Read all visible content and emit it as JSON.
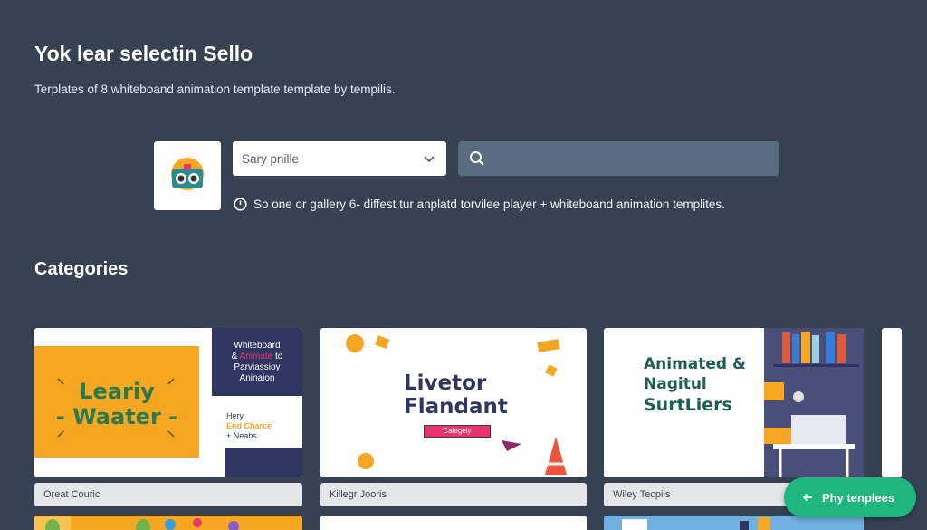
{
  "header": {
    "title": "Yok lear selectin Sello",
    "subtitle": "Terplates of 8 whiteboand animation template template by tempilis."
  },
  "controls": {
    "select_value": "Sary pnille",
    "search_placeholder": "",
    "hint": "So one or gallery 6- diffest tur anplatd torvilee player + whiteboand animation templites."
  },
  "categories": {
    "heading": "Categories",
    "cards": [
      {
        "label": "Oreat Couric",
        "big_text_line1": "Leariy",
        "big_text_line2": "- Waater -",
        "side_line1": "Whiteboard",
        "side_line2_a": "&",
        "side_line2_b": "Animate",
        "side_line2_c": "to",
        "side_line3": "Parviassioy",
        "side_line4": "Aninaion",
        "small_line1": "Hery",
        "small_line2": "End Charce",
        "small_line3": "+ Neabs"
      },
      {
        "label": "Killegr Jooris",
        "big_text_line1": "Livetor",
        "big_text_line2": "Flandant",
        "tag": "Calegely"
      },
      {
        "label": "Wiley Tecpils",
        "big_text_line1": "Animated &",
        "big_text_line2": "Nagitul",
        "big_text_line3": "SurtLiers"
      }
    ]
  },
  "fab": {
    "label": "Phy tenplees"
  },
  "colors": {
    "background": "#364152",
    "orange": "#f5a623",
    "navy": "#2e3661",
    "green_text": "#2c7a4b",
    "accent_green": "#1fb681",
    "pink": "#e8336d"
  }
}
